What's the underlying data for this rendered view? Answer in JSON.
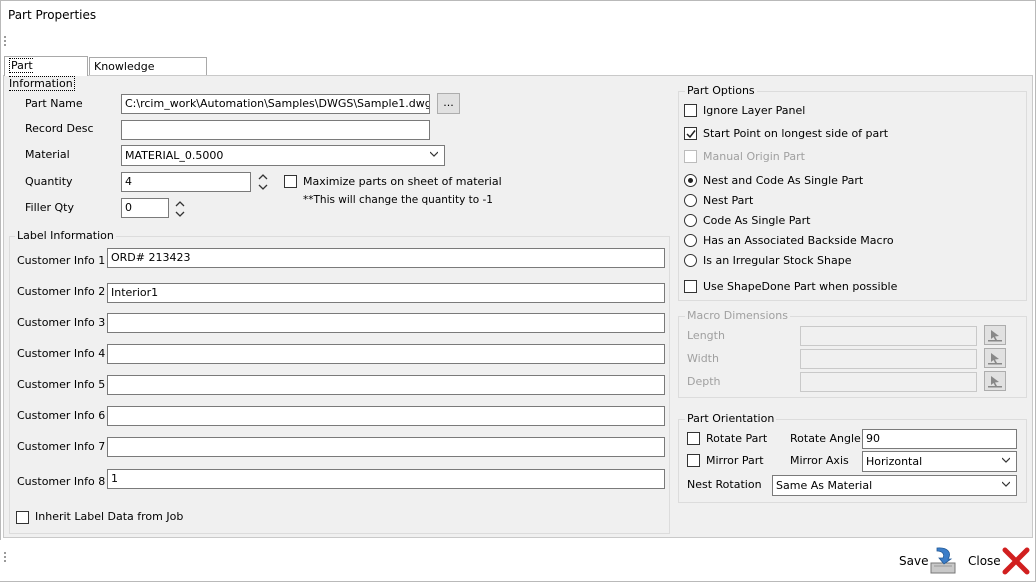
{
  "window": {
    "title": "Part Properties"
  },
  "tabs": [
    {
      "label": "Part Information",
      "active": true
    },
    {
      "label": "Knowledge Information",
      "active": false
    }
  ],
  "part": {
    "part_name_label": "Part Name",
    "part_name_value": "C:\\rcim_work\\Automation\\Samples\\DWGS\\Sample1.dwg",
    "browse_label": "...",
    "record_desc_label": "Record Desc",
    "record_desc_value": "",
    "material_label": "Material",
    "material_value": "MATERIAL_0.5000",
    "quantity_label": "Quantity",
    "quantity_value": "4",
    "filler_qty_label": "Filler Qty",
    "filler_qty_value": "0",
    "maximize_label": "Maximize parts on sheet of material",
    "maximize_note": "**This will change the quantity to -1"
  },
  "label_info": {
    "title": "Label Information",
    "fields": [
      {
        "label": "Customer Info 1",
        "value": "ORD# 213423"
      },
      {
        "label": "Customer Info 2",
        "value": "Interior1"
      },
      {
        "label": "Customer Info 3",
        "value": ""
      },
      {
        "label": "Customer Info 4",
        "value": ""
      },
      {
        "label": "Customer Info 5",
        "value": ""
      },
      {
        "label": "Customer Info 6",
        "value": ""
      },
      {
        "label": "Customer Info 7",
        "value": ""
      },
      {
        "label": "Customer Info 8",
        "value": "1"
      }
    ],
    "inherit_label": "Inherit Label Data from Job"
  },
  "part_options": {
    "title": "Part Options",
    "ignore_layer": {
      "label": "Ignore Layer Panel",
      "checked": false
    },
    "start_point": {
      "label": "Start Point on longest side of part",
      "checked": true
    },
    "manual_origin": {
      "label": "Manual Origin Part",
      "checked": false,
      "disabled": true
    },
    "radios": [
      {
        "label": "Nest and Code As Single Part",
        "selected": true
      },
      {
        "label": "Nest Part",
        "selected": false
      },
      {
        "label": "Code As Single Part",
        "selected": false
      },
      {
        "label": "Has an Associated Backside Macro",
        "selected": false
      },
      {
        "label": "Is an Irregular Stock Shape",
        "selected": false
      }
    ],
    "shapedone": {
      "label": "Use ShapeDone Part when possible",
      "checked": false
    }
  },
  "macro_dims": {
    "title": "Macro Dimensions",
    "length_label": "Length",
    "width_label": "Width",
    "depth_label": "Depth"
  },
  "orientation": {
    "title": "Part Orientation",
    "rotate_part_label": "Rotate Part",
    "rotate_angle_label": "Rotate Angle",
    "rotate_angle_value": "90",
    "mirror_part_label": "Mirror Part",
    "mirror_axis_label": "Mirror Axis",
    "mirror_axis_value": "Horizontal",
    "nest_rotation_label": "Nest Rotation",
    "nest_rotation_value": "Same As Material"
  },
  "footer": {
    "save_label": "Save",
    "close_label": "Close"
  }
}
